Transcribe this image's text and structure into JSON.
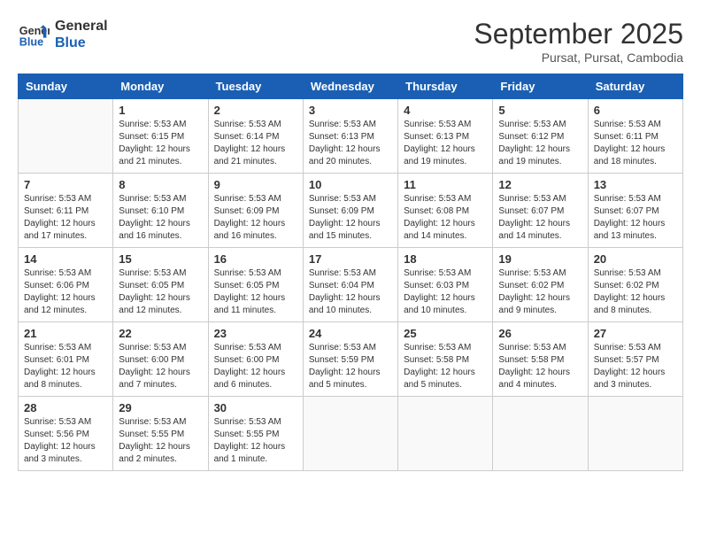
{
  "logo": {
    "line1": "General",
    "line2": "Blue"
  },
  "title": "September 2025",
  "location": "Pursat, Pursat, Cambodia",
  "weekdays": [
    "Sunday",
    "Monday",
    "Tuesday",
    "Wednesday",
    "Thursday",
    "Friday",
    "Saturday"
  ],
  "weeks": [
    [
      {
        "day": "",
        "content": ""
      },
      {
        "day": "1",
        "content": "Sunrise: 5:53 AM\nSunset: 6:15 PM\nDaylight: 12 hours\nand 21 minutes."
      },
      {
        "day": "2",
        "content": "Sunrise: 5:53 AM\nSunset: 6:14 PM\nDaylight: 12 hours\nand 21 minutes."
      },
      {
        "day": "3",
        "content": "Sunrise: 5:53 AM\nSunset: 6:13 PM\nDaylight: 12 hours\nand 20 minutes."
      },
      {
        "day": "4",
        "content": "Sunrise: 5:53 AM\nSunset: 6:13 PM\nDaylight: 12 hours\nand 19 minutes."
      },
      {
        "day": "5",
        "content": "Sunrise: 5:53 AM\nSunset: 6:12 PM\nDaylight: 12 hours\nand 19 minutes."
      },
      {
        "day": "6",
        "content": "Sunrise: 5:53 AM\nSunset: 6:11 PM\nDaylight: 12 hours\nand 18 minutes."
      }
    ],
    [
      {
        "day": "7",
        "content": "Sunrise: 5:53 AM\nSunset: 6:11 PM\nDaylight: 12 hours\nand 17 minutes."
      },
      {
        "day": "8",
        "content": "Sunrise: 5:53 AM\nSunset: 6:10 PM\nDaylight: 12 hours\nand 16 minutes."
      },
      {
        "day": "9",
        "content": "Sunrise: 5:53 AM\nSunset: 6:09 PM\nDaylight: 12 hours\nand 16 minutes."
      },
      {
        "day": "10",
        "content": "Sunrise: 5:53 AM\nSunset: 6:09 PM\nDaylight: 12 hours\nand 15 minutes."
      },
      {
        "day": "11",
        "content": "Sunrise: 5:53 AM\nSunset: 6:08 PM\nDaylight: 12 hours\nand 14 minutes."
      },
      {
        "day": "12",
        "content": "Sunrise: 5:53 AM\nSunset: 6:07 PM\nDaylight: 12 hours\nand 14 minutes."
      },
      {
        "day": "13",
        "content": "Sunrise: 5:53 AM\nSunset: 6:07 PM\nDaylight: 12 hours\nand 13 minutes."
      }
    ],
    [
      {
        "day": "14",
        "content": "Sunrise: 5:53 AM\nSunset: 6:06 PM\nDaylight: 12 hours\nand 12 minutes."
      },
      {
        "day": "15",
        "content": "Sunrise: 5:53 AM\nSunset: 6:05 PM\nDaylight: 12 hours\nand 12 minutes."
      },
      {
        "day": "16",
        "content": "Sunrise: 5:53 AM\nSunset: 6:05 PM\nDaylight: 12 hours\nand 11 minutes."
      },
      {
        "day": "17",
        "content": "Sunrise: 5:53 AM\nSunset: 6:04 PM\nDaylight: 12 hours\nand 10 minutes."
      },
      {
        "day": "18",
        "content": "Sunrise: 5:53 AM\nSunset: 6:03 PM\nDaylight: 12 hours\nand 10 minutes."
      },
      {
        "day": "19",
        "content": "Sunrise: 5:53 AM\nSunset: 6:02 PM\nDaylight: 12 hours\nand 9 minutes."
      },
      {
        "day": "20",
        "content": "Sunrise: 5:53 AM\nSunset: 6:02 PM\nDaylight: 12 hours\nand 8 minutes."
      }
    ],
    [
      {
        "day": "21",
        "content": "Sunrise: 5:53 AM\nSunset: 6:01 PM\nDaylight: 12 hours\nand 8 minutes."
      },
      {
        "day": "22",
        "content": "Sunrise: 5:53 AM\nSunset: 6:00 PM\nDaylight: 12 hours\nand 7 minutes."
      },
      {
        "day": "23",
        "content": "Sunrise: 5:53 AM\nSunset: 6:00 PM\nDaylight: 12 hours\nand 6 minutes."
      },
      {
        "day": "24",
        "content": "Sunrise: 5:53 AM\nSunset: 5:59 PM\nDaylight: 12 hours\nand 5 minutes."
      },
      {
        "day": "25",
        "content": "Sunrise: 5:53 AM\nSunset: 5:58 PM\nDaylight: 12 hours\nand 5 minutes."
      },
      {
        "day": "26",
        "content": "Sunrise: 5:53 AM\nSunset: 5:58 PM\nDaylight: 12 hours\nand 4 minutes."
      },
      {
        "day": "27",
        "content": "Sunrise: 5:53 AM\nSunset: 5:57 PM\nDaylight: 12 hours\nand 3 minutes."
      }
    ],
    [
      {
        "day": "28",
        "content": "Sunrise: 5:53 AM\nSunset: 5:56 PM\nDaylight: 12 hours\nand 3 minutes."
      },
      {
        "day": "29",
        "content": "Sunrise: 5:53 AM\nSunset: 5:55 PM\nDaylight: 12 hours\nand 2 minutes."
      },
      {
        "day": "30",
        "content": "Sunrise: 5:53 AM\nSunset: 5:55 PM\nDaylight: 12 hours\nand 1 minute."
      },
      {
        "day": "",
        "content": ""
      },
      {
        "day": "",
        "content": ""
      },
      {
        "day": "",
        "content": ""
      },
      {
        "day": "",
        "content": ""
      }
    ]
  ]
}
